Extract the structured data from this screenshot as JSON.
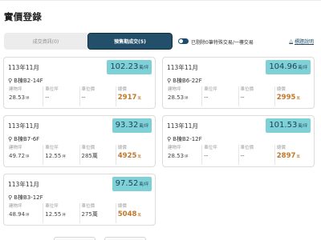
{
  "page": {
    "title": "實價登錄"
  },
  "tabs": [
    {
      "label": "成交資訊(0)"
    },
    {
      "label": "預售期成交(5)"
    }
  ],
  "filter": {
    "toggle_label": "已剔除0筆特殊交易/一樓交易",
    "explain_label": "標題說明",
    "explain_icon": "△"
  },
  "units": {
    "price": "萬/坪",
    "area": "坪",
    "total": "萬"
  },
  "stat_labels": {
    "area": "建物坪",
    "parking_area": "車位坪",
    "parking_price": "車位價",
    "total": "總價"
  },
  "records": [
    {
      "date": "113年11月",
      "price": "102.23",
      "location": "B棟B2-14F",
      "area": "28.53",
      "parking_area": "--",
      "parking_price": "--",
      "total": "2917"
    },
    {
      "date": "113年11月",
      "price": "104.96",
      "location": "B棟B6-22F",
      "area": "28.53",
      "parking_area": "--",
      "parking_price": "--",
      "total": "2995"
    },
    {
      "date": "113年11月",
      "price": "93.32",
      "location": "B棟B7-6F",
      "area": "49.72",
      "parking_area": "12.55",
      "parking_price": "285萬",
      "total": "4925"
    },
    {
      "date": "113年11月",
      "price": "101.53",
      "location": "B棟B2-12F",
      "area": "28.53",
      "parking_area": "--",
      "parking_price": "--",
      "total": "2897"
    },
    {
      "date": "113年11月",
      "price": "97.52",
      "location": "B棟B3-12F",
      "area": "48.94",
      "parking_area": "12.55",
      "parking_price": "275萬",
      "total": "5048"
    }
  ],
  "icons": {
    "location": "map-pin-icon"
  },
  "colors": {
    "accent": "#234f6a",
    "price_badge": "#7fd1d8",
    "total": "#c0782c"
  }
}
